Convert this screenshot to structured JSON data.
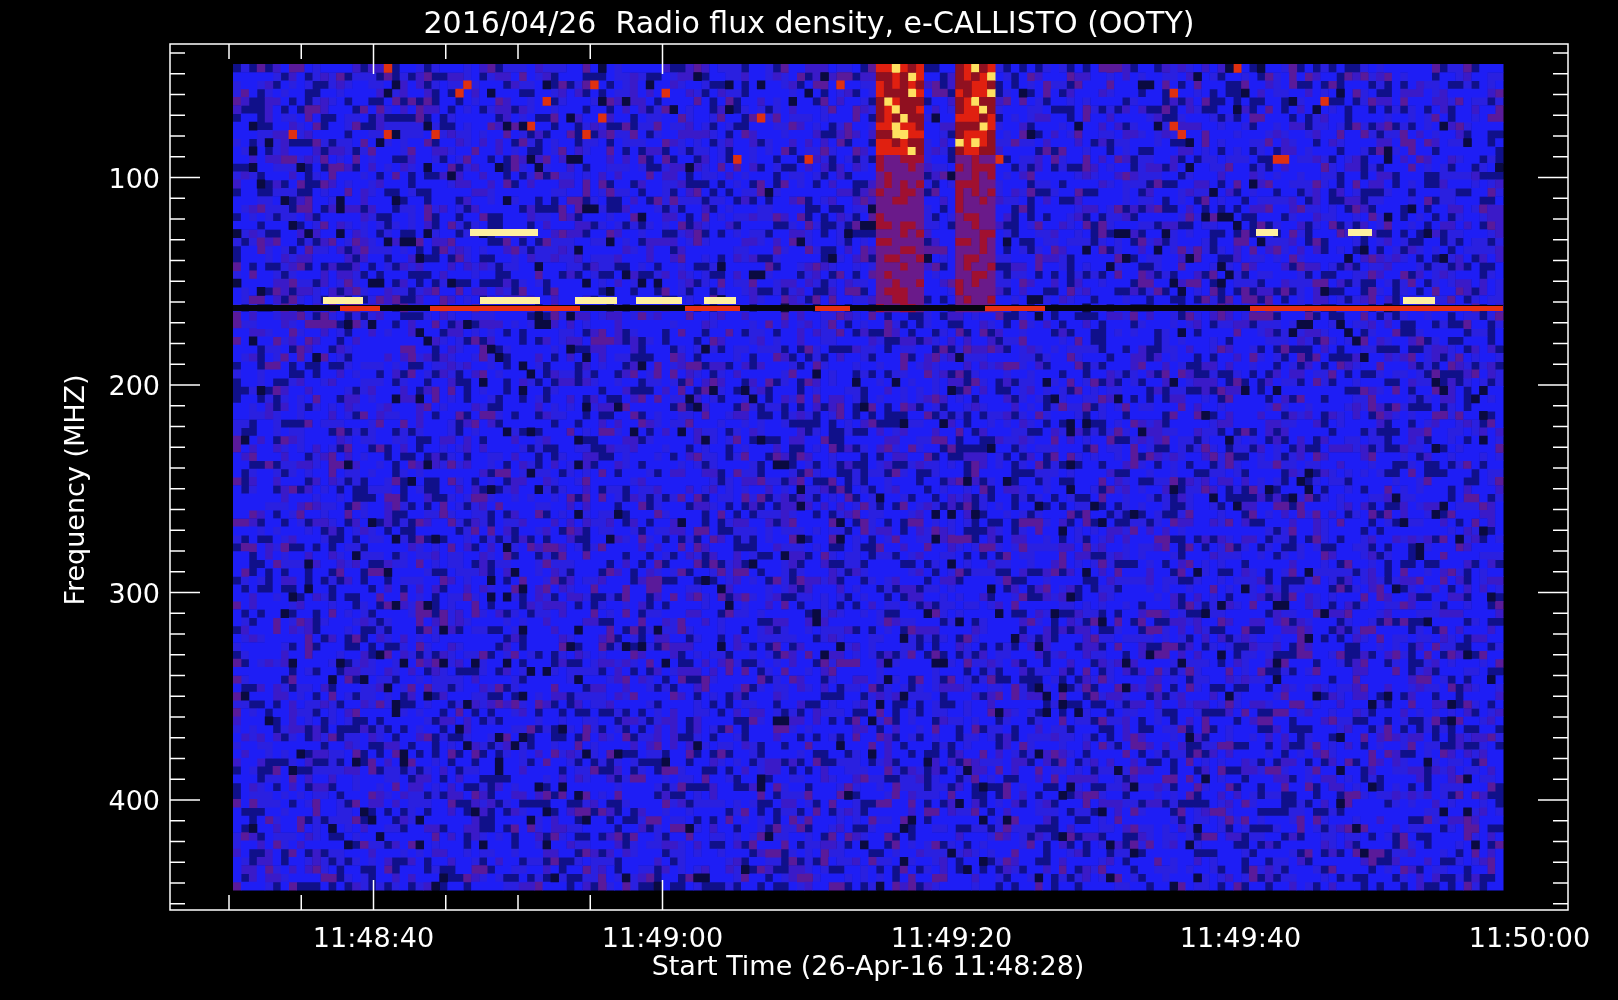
{
  "title": "2016/04/26  Radio flux density, e-CALLISTO (OOTY)",
  "y_axis": {
    "label": "Frequency (MHZ)",
    "ticks": [
      "100",
      "200",
      "300",
      "400"
    ]
  },
  "x_axis": {
    "label": "Start Time (26-Apr-16 11:48:28)",
    "ticks": [
      "11:48:40",
      "11:49:00",
      "11:49:20",
      "11:49:40",
      "11:50:00"
    ]
  }
}
